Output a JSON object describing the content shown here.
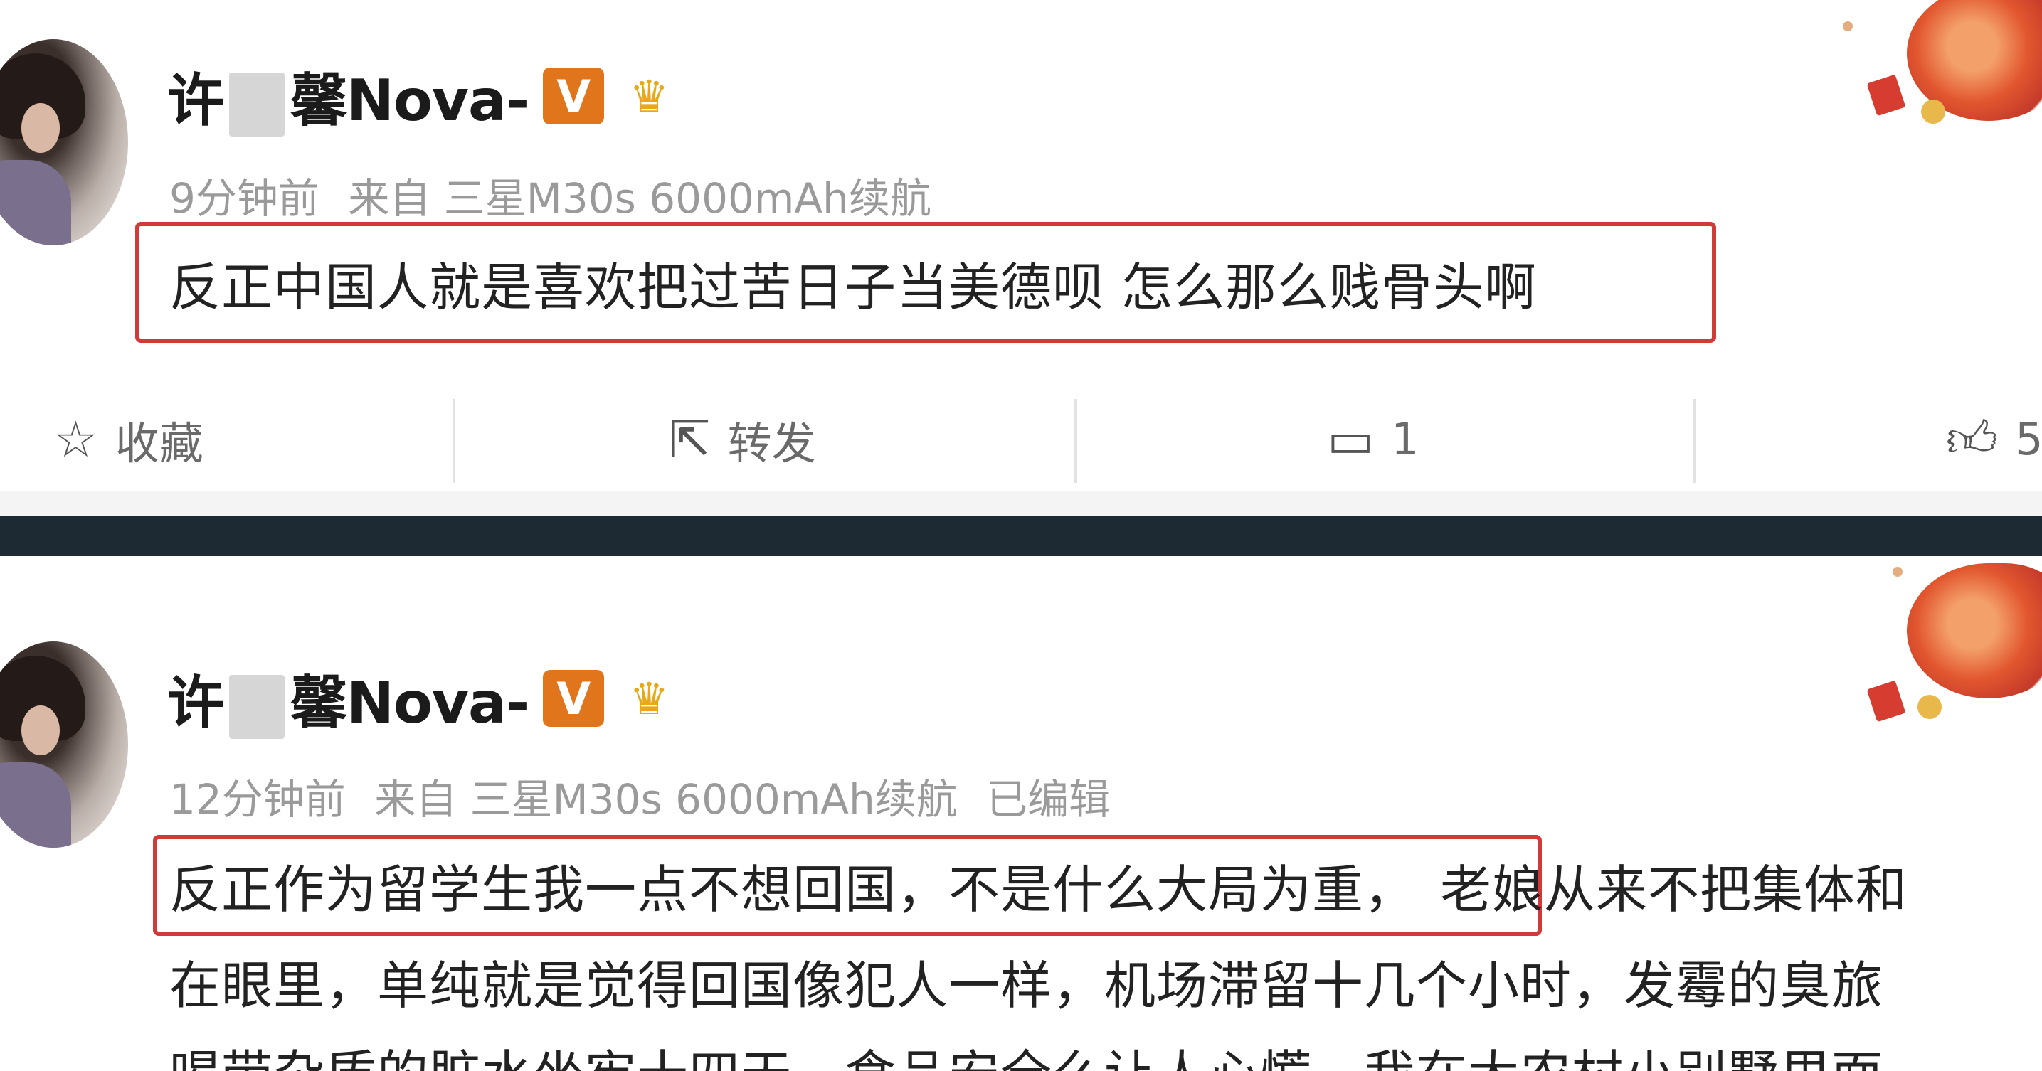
{
  "posts": [
    {
      "user": {
        "name_prefix": "许",
        "name_suffix": "馨Nova-",
        "vip_badge": "V"
      },
      "meta": {
        "time": "9分钟前",
        "source": "来自 三星M30s 6000mAh续航",
        "edited": ""
      },
      "content_highlight": "反正中国人就是喜欢把过苦日子当美德呗 怎么那么贱骨头啊",
      "actions": {
        "favorite_label": "收藏",
        "repost_label": "转发",
        "comment_count": "1",
        "like_count": "5"
      }
    },
    {
      "user": {
        "name_prefix": "许",
        "name_suffix": "馨Nova-",
        "vip_badge": "V"
      },
      "meta": {
        "time": "12分钟前",
        "source": "来自 三星M30s 6000mAh续航",
        "edited": "已编辑"
      },
      "content_highlight": "反正作为留学生我一点不想回国，不是什么大局为重，",
      "content_rest_line1": "老娘从来不把集体和",
      "content_line2": "在眼里，单纯就是觉得回国像犯人一样，机场滞留十几个小时，发霉的臭旅",
      "content_line3": "喝带杂质的脏水坐牢十四天，食品安全么让人心慌，我在大农村小别墅里面"
    }
  ],
  "icons": [
    "star-icon",
    "share-icon",
    "comment-icon",
    "thumb-up-icon",
    "crown-icon"
  ],
  "colors": {
    "highlight_border": "#d23a3a",
    "vip": "#e0751c",
    "divider": "#1e2a33",
    "meta_text": "#9a9a9a"
  }
}
